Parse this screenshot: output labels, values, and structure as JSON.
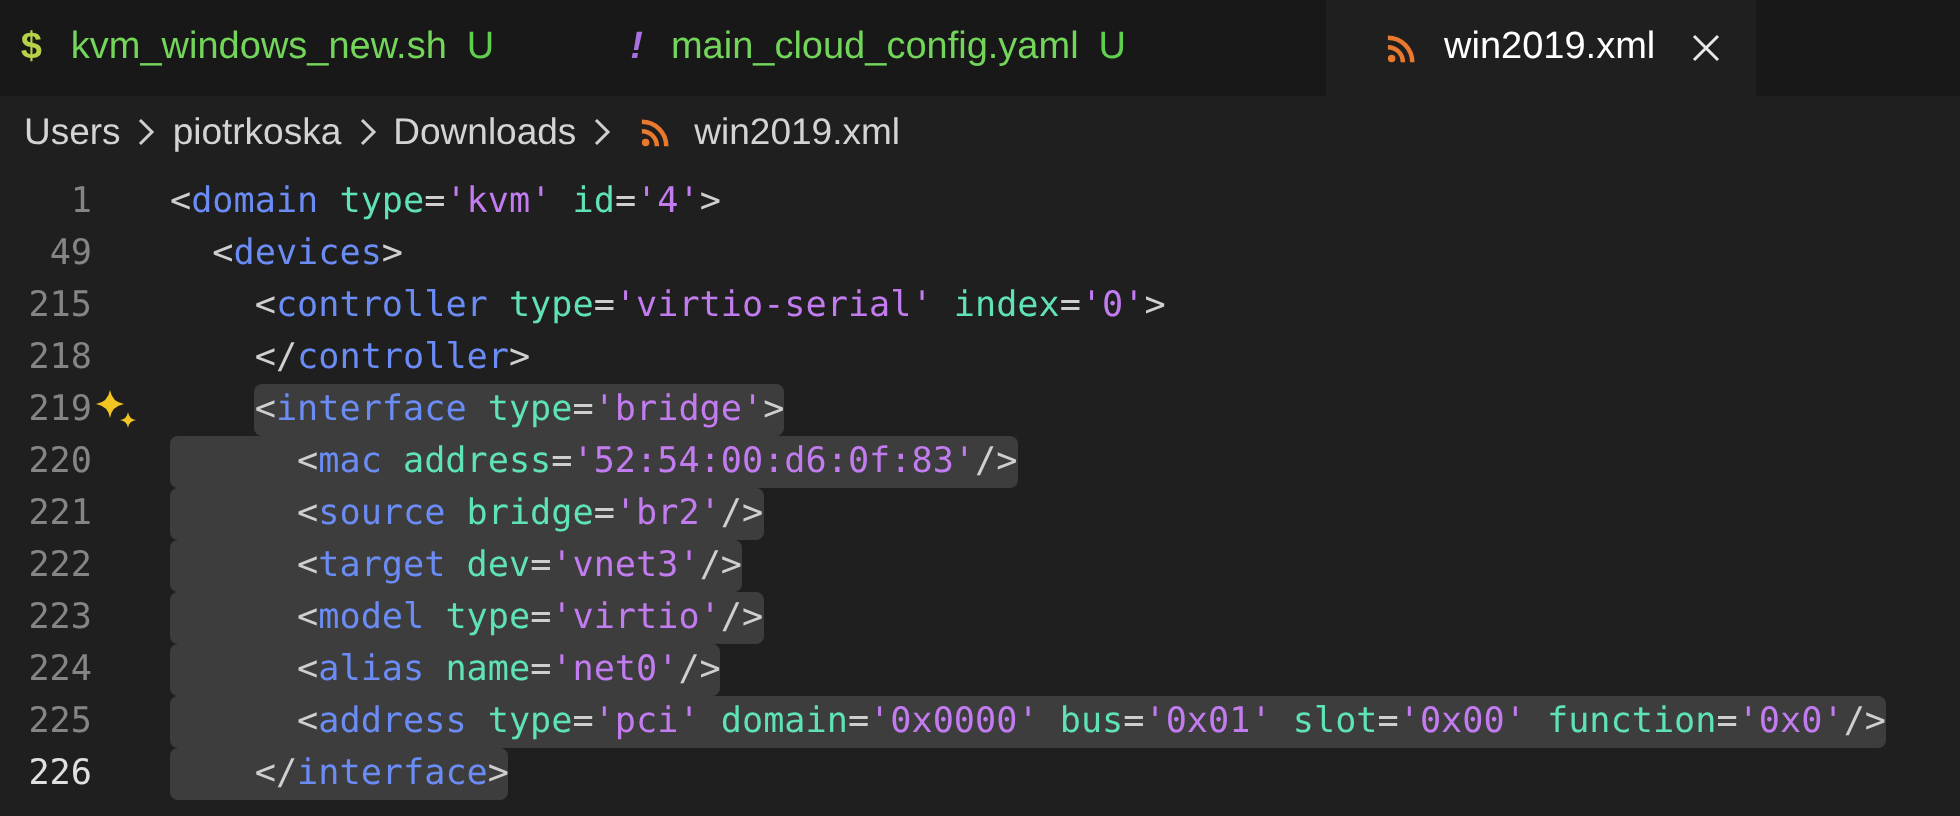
{
  "tabs": [
    {
      "icon": "$",
      "kind": "shell",
      "label": "kvm_windows_new.sh",
      "status": "U",
      "selected": false
    },
    {
      "icon": "!",
      "kind": "yaml",
      "label": "main_cloud_config.yaml",
      "status": "U",
      "selected": false
    },
    {
      "kind": "xml",
      "label": "win2019.xml",
      "selected": true
    }
  ],
  "breadcrumbs": [
    {
      "label": "Users"
    },
    {
      "label": "piotrkoska"
    },
    {
      "label": "Downloads"
    },
    {
      "label": "win2019.xml",
      "kind": "xml"
    }
  ],
  "lines": [
    {
      "number": "1",
      "tokens": [
        {
          "kind": "punct",
          "text": "<"
        },
        {
          "kind": "tag",
          "text": "domain"
        },
        {
          "kind": "attr",
          "text": "type"
        },
        {
          "kind": "punct",
          "text": "="
        },
        {
          "kind": "string",
          "text": "'kvm'"
        },
        {
          "kind": "attr",
          "text": "id"
        },
        {
          "kind": "punct",
          "text": "="
        },
        {
          "kind": "string",
          "text": "'4'"
        },
        {
          "kind": "punct",
          "text": ">"
        }
      ],
      "selected": false,
      "children": [
        {
          "number": "49",
          "tokens": [
            {
              "kind": "punct",
              "text": "<"
            },
            {
              "kind": "tag",
              "text": "devices"
            },
            {
              "kind": "punct",
              "text": ">"
            }
          ],
          "selected": false,
          "children": [
            {
              "number": "215",
              "tokens": [
                {
                  "kind": "punct",
                  "text": "<"
                },
                {
                  "kind": "tag",
                  "text": "controller"
                },
                {
                  "kind": "attr",
                  "text": "type"
                },
                {
                  "kind": "punct",
                  "text": "="
                },
                {
                  "kind": "string",
                  "text": "'virtio-serial'"
                },
                {
                  "kind": "attr",
                  "text": "index"
                },
                {
                  "kind": "punct",
                  "text": "="
                },
                {
                  "kind": "string",
                  "text": "'0'"
                },
                {
                  "kind": "punct",
                  "text": ">"
                }
              ],
              "selected": false
            },
            {
              "number": "218",
              "tokens": [
                {
                  "kind": "punct",
                  "text": "</"
                },
                {
                  "kind": "tag",
                  "text": "controller"
                },
                {
                  "kind": "punct",
                  "text": ">"
                }
              ],
              "selected": false
            },
            {
              "number": "219",
              "sparkle": true,
              "tokens": [
                {
                  "kind": "punct",
                  "text": "<"
                },
                {
                  "kind": "tag",
                  "text": "interface"
                },
                {
                  "kind": "attr",
                  "text": "type"
                },
                {
                  "kind": "punct",
                  "text": "="
                },
                {
                  "kind": "string",
                  "text": "'bridge'"
                },
                {
                  "kind": "punct",
                  "text": ">"
                }
              ],
              "selected": true,
              "children": [
                {
                  "number": "220",
                  "tokens": [
                    {
                      "kind": "punct",
                      "text": "<"
                    },
                    {
                      "kind": "tag",
                      "text": "mac"
                    },
                    {
                      "kind": "attr",
                      "text": "address"
                    },
                    {
                      "kind": "punct",
                      "text": "="
                    },
                    {
                      "kind": "string",
                      "text": "'52:54:00:d6:0f:83'"
                    },
                    {
                      "kind": "punct",
                      "text": "/>"
                    }
                  ],
                  "selected": true
                },
                {
                  "number": "221",
                  "tokens": [
                    {
                      "kind": "punct",
                      "text": "<"
                    },
                    {
                      "kind": "tag",
                      "text": "source"
                    },
                    {
                      "kind": "attr",
                      "text": "bridge"
                    },
                    {
                      "kind": "punct",
                      "text": "="
                    },
                    {
                      "kind": "string",
                      "text": "'br2'"
                    },
                    {
                      "kind": "punct",
                      "text": "/>"
                    }
                  ],
                  "selected": true
                },
                {
                  "number": "222",
                  "tokens": [
                    {
                      "kind": "punct",
                      "text": "<"
                    },
                    {
                      "kind": "tag",
                      "text": "target"
                    },
                    {
                      "kind": "attr",
                      "text": "dev"
                    },
                    {
                      "kind": "punct",
                      "text": "="
                    },
                    {
                      "kind": "string",
                      "text": "'vnet3'"
                    },
                    {
                      "kind": "punct",
                      "text": "/>"
                    }
                  ],
                  "selected": true
                },
                {
                  "number": "223",
                  "tokens": [
                    {
                      "kind": "punct",
                      "text": "<"
                    },
                    {
                      "kind": "tag",
                      "text": "model"
                    },
                    {
                      "kind": "attr",
                      "text": "type"
                    },
                    {
                      "kind": "punct",
                      "text": "="
                    },
                    {
                      "kind": "string",
                      "text": "'virtio'"
                    },
                    {
                      "kind": "punct",
                      "text": "/>"
                    }
                  ],
                  "selected": true
                },
                {
                  "number": "224",
                  "tokens": [
                    {
                      "kind": "punct",
                      "text": "<"
                    },
                    {
                      "kind": "tag",
                      "text": "alias"
                    },
                    {
                      "kind": "attr",
                      "text": "name"
                    },
                    {
                      "kind": "punct",
                      "text": "="
                    },
                    {
                      "kind": "string",
                      "text": "'net0'"
                    },
                    {
                      "kind": "punct",
                      "text": "/>"
                    }
                  ],
                  "selected": true
                },
                {
                  "number": "225",
                  "tokens": [
                    {
                      "kind": "punct",
                      "text": "<"
                    },
                    {
                      "kind": "tag",
                      "text": "address"
                    },
                    {
                      "kind": "attr",
                      "text": "type"
                    },
                    {
                      "kind": "punct",
                      "text": "="
                    },
                    {
                      "kind": "string",
                      "text": "'pci'"
                    },
                    {
                      "kind": "attr",
                      "text": "domain"
                    },
                    {
                      "kind": "punct",
                      "text": "="
                    },
                    {
                      "kind": "string",
                      "text": "'0x0000'"
                    },
                    {
                      "kind": "attr",
                      "text": "bus"
                    },
                    {
                      "kind": "punct",
                      "text": "="
                    },
                    {
                      "kind": "string",
                      "text": "'0x01'"
                    },
                    {
                      "kind": "attr",
                      "text": "slot"
                    },
                    {
                      "kind": "punct",
                      "text": "="
                    },
                    {
                      "kind": "string",
                      "text": "'0x00'"
                    },
                    {
                      "kind": "attr",
                      "text": "function"
                    },
                    {
                      "kind": "punct",
                      "text": "="
                    },
                    {
                      "kind": "string",
                      "text": "'0x0'"
                    },
                    {
                      "kind": "punct",
                      "text": "/>"
                    }
                  ],
                  "selected": true
                }
              ]
            },
            {
              "number": "226",
              "current": true,
              "tokens": [
                {
                  "kind": "punct",
                  "text": "</"
                },
                {
                  "kind": "tag",
                  "text": "interface"
                },
                {
                  "kind": "punct",
                  "text": ">"
                }
              ],
              "selected": true
            }
          ]
        }
      ]
    }
  ]
}
